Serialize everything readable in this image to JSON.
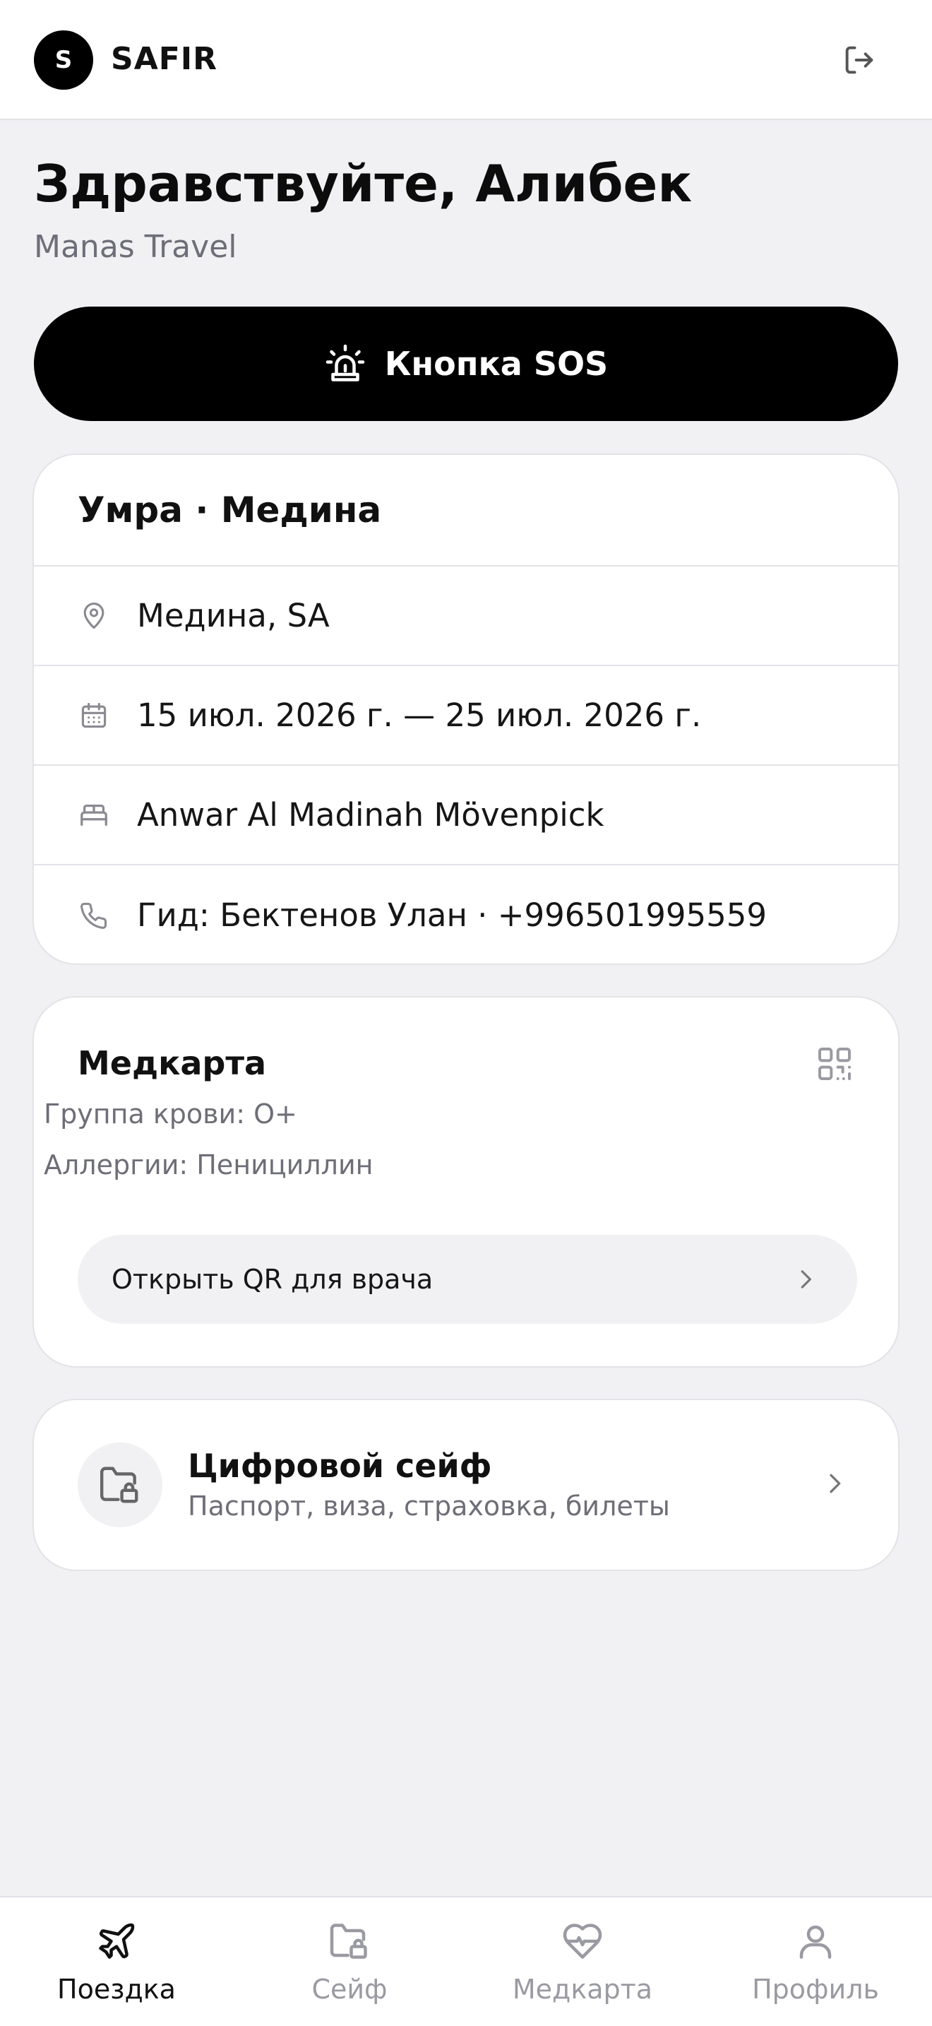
{
  "header": {
    "logo_letter": "S",
    "brand": "SAFIR"
  },
  "greeting": {
    "title": "Здравствуйте, Алибек",
    "agency": "Manas Travel"
  },
  "sos": {
    "label": "Кнопка SOS"
  },
  "trip": {
    "title": "Умра · Медина",
    "location": "Медина, SA",
    "dates": "15 июл. 2026 г. — 25 июл. 2026 г.",
    "hotel": "Anwar Al Madinah Mövenpick",
    "guide": "Гид: Бектенов Улан · +996501995559"
  },
  "medcard": {
    "title": "Медкарта",
    "blood_group": "Группа крови: O+",
    "allergies": "Аллергии: Пенициллин",
    "qr_button": "Открыть QR для врача"
  },
  "safe": {
    "title": "Цифровой сейф",
    "subtitle": "Паспорт, виза, страховка, билеты"
  },
  "nav": {
    "items": [
      {
        "label": "Поездка",
        "icon": "plane-icon",
        "active": true
      },
      {
        "label": "Сейф",
        "icon": "folder-lock-icon",
        "active": false
      },
      {
        "label": "Медкарта",
        "icon": "heart-pulse-icon",
        "active": false
      },
      {
        "label": "Профиль",
        "icon": "user-icon",
        "active": false
      }
    ]
  },
  "colors": {
    "background": "#f1f1f4",
    "primary": "#000000",
    "muted_text": "#6e6e78",
    "nav_inactive": "#9a9aa2"
  }
}
